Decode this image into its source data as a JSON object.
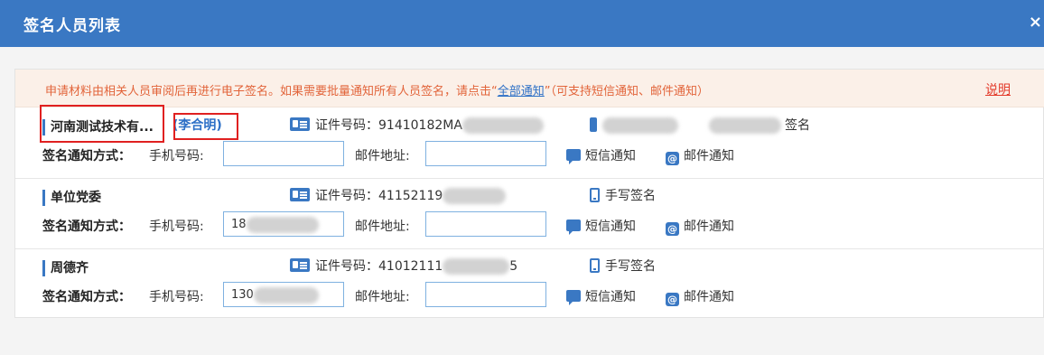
{
  "window": {
    "title": "签名人员列表",
    "close_label": "×"
  },
  "notice": {
    "text_before": "申请材料由相关人员审阅后再进行电子签名。如果需要批量通知所有人员签名，请点击“",
    "link": "全部通知",
    "text_after": "”（可支持短信通知、邮件通知）",
    "help": "说明"
  },
  "labels": {
    "method": "签名通知方式：",
    "mobile": "手机号码:",
    "email": "邮件地址:",
    "sms": "短信通知",
    "email_notify": "邮件通知",
    "handwrite": "手写签名",
    "cert_prefix": "证件号码："
  },
  "signers": [
    {
      "name": "河南测试技术有...",
      "contact": "(李合明)",
      "cert_visible": "91410182MA",
      "sign_visible_a": "",
      "sign_visible_b": "签名",
      "mobile_value": "",
      "email_value": ""
    },
    {
      "name": "单位党委",
      "contact": "",
      "cert_visible": "41152119",
      "sign_visible": "手写签名",
      "mobile_value": "18",
      "email_value": ""
    },
    {
      "name": "周德齐",
      "contact": "",
      "cert_visible": "41012111",
      "cert_tail": "5",
      "sign_visible": "手写签名",
      "mobile_value": "130",
      "email_value": ""
    }
  ]
}
